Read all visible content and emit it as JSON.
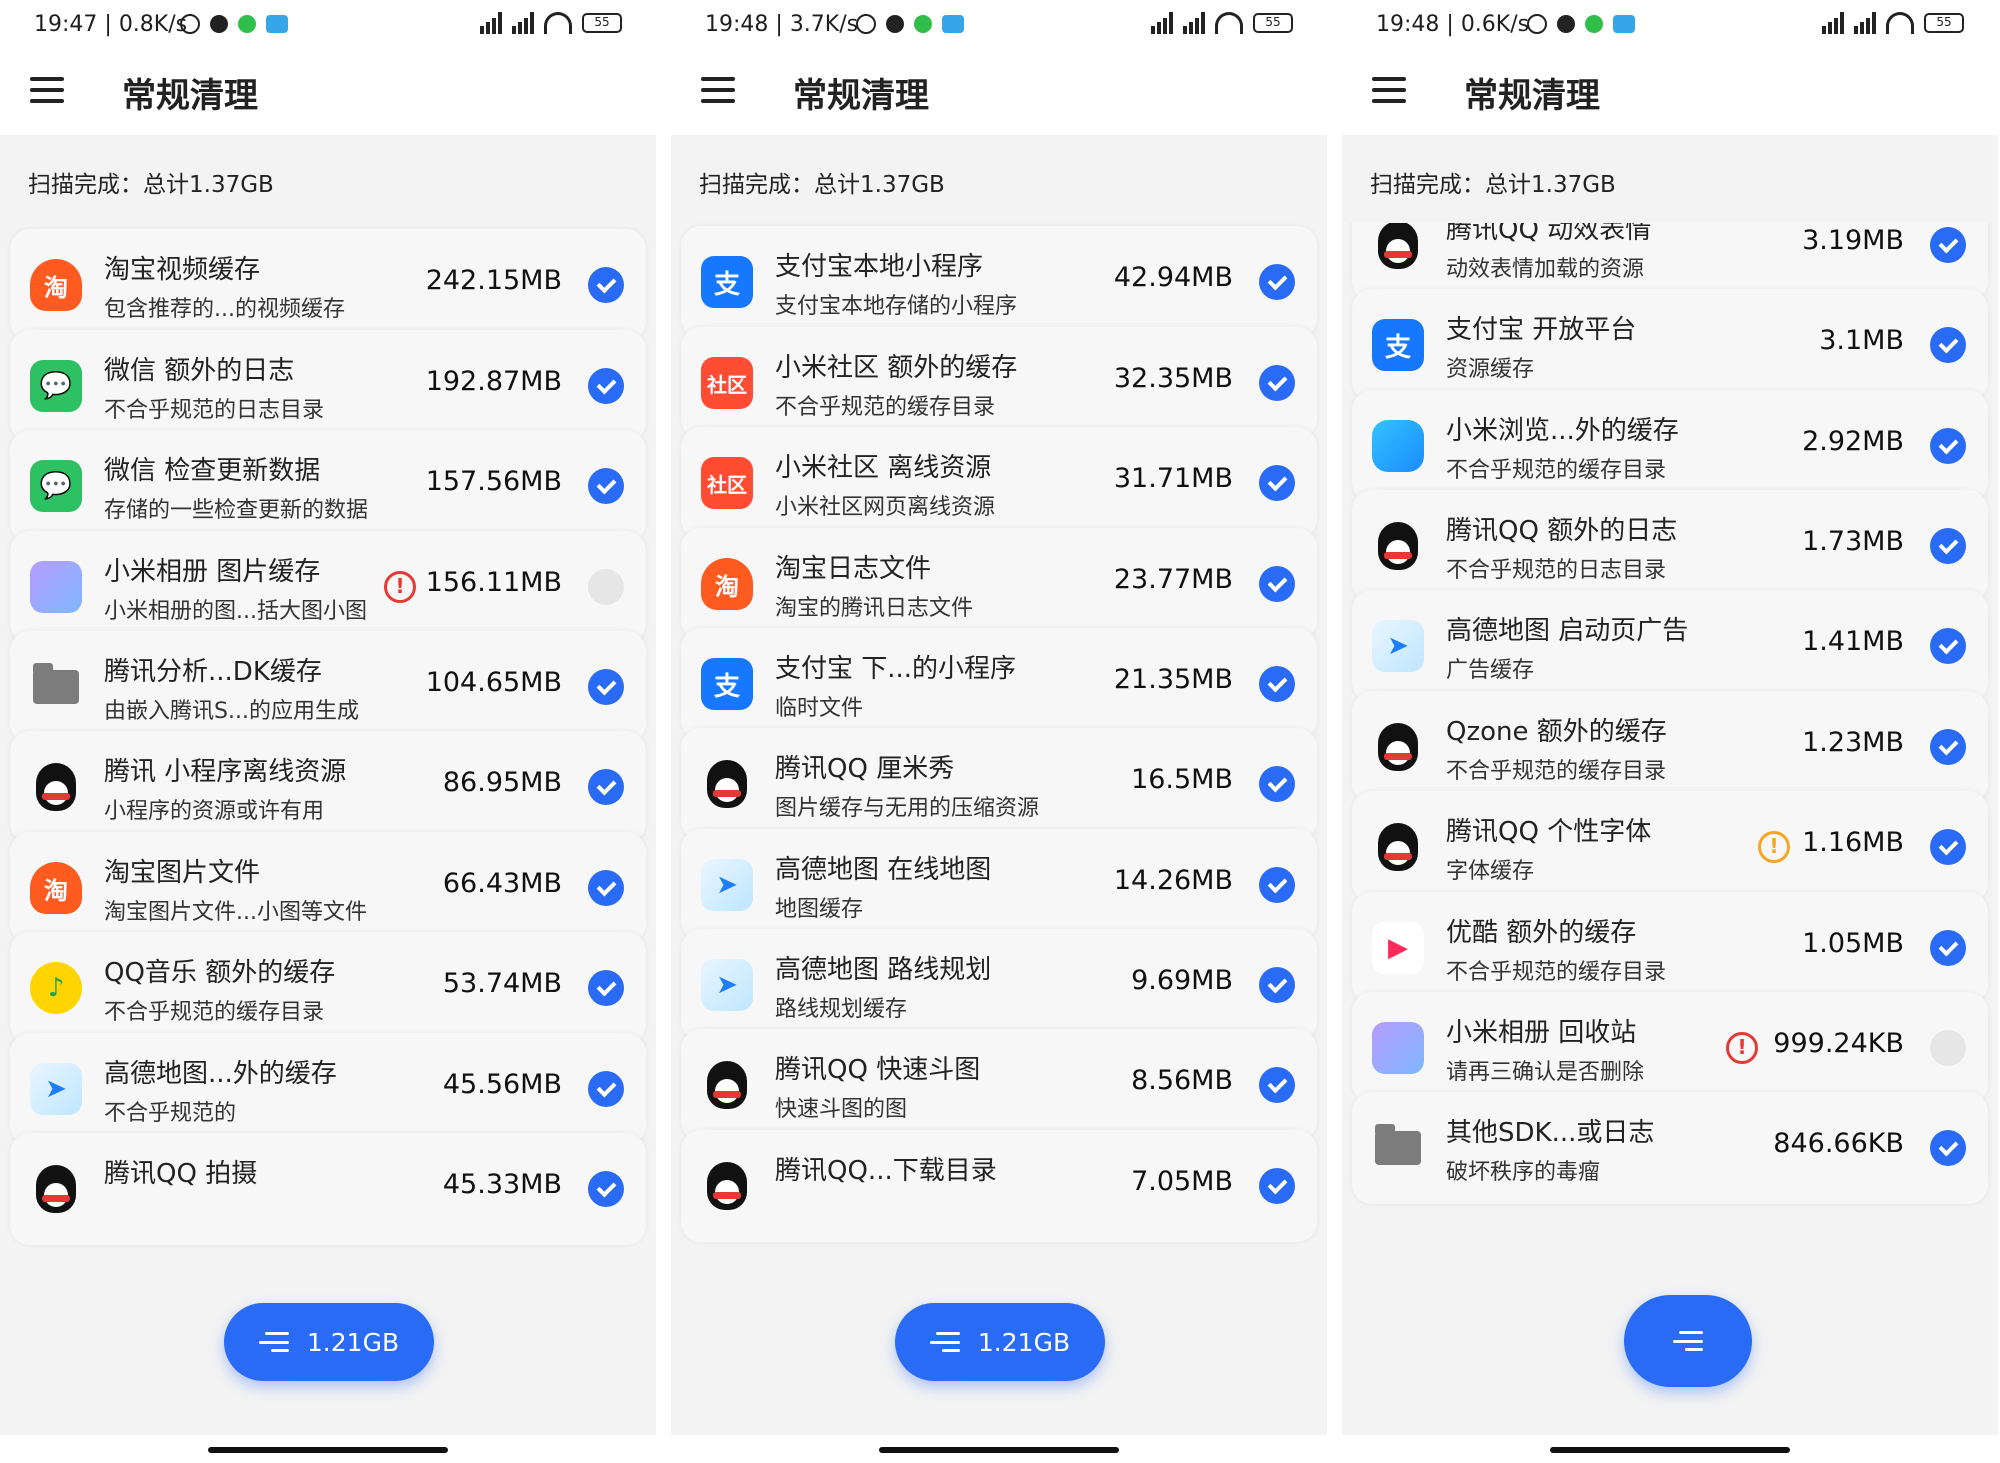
{
  "panels": [
    {
      "status": {
        "time": "19:47",
        "speed": "0.8K/s",
        "battery": "55"
      },
      "title": "常规清理",
      "scan_summary": "扫描完成：总计1.37GB",
      "fab_label": "1.21GB",
      "items": [
        {
          "icon": "taobao-icon",
          "title": "淘宝视频缓存",
          "subtitle": "包含推荐的...的视频缓存",
          "size": "242.15MB",
          "checked": true,
          "warn": ""
        },
        {
          "icon": "wechat-icon",
          "title": "微信 额外的日志",
          "subtitle": "不合乎规范的日志目录",
          "size": "192.87MB",
          "checked": true,
          "warn": ""
        },
        {
          "icon": "wechat-icon",
          "title": "微信 检查更新数据",
          "subtitle": "存储的一些检查更新的数据",
          "size": "157.56MB",
          "checked": true,
          "warn": ""
        },
        {
          "icon": "xiaomi-album-icon",
          "title": "小米相册 图片缓存",
          "subtitle": "小米相册的图...括大图小图",
          "size": "156.11MB",
          "checked": false,
          "warn": "red"
        },
        {
          "icon": "folder-icon",
          "title": "腾讯分析...DK缓存",
          "subtitle": "由嵌入腾讯S...的应用生成",
          "size": "104.65MB",
          "checked": true,
          "warn": ""
        },
        {
          "icon": "qq-icon",
          "title": "腾讯 小程序离线资源",
          "subtitle": "小程序的资源或许有用",
          "size": "86.95MB",
          "checked": true,
          "warn": ""
        },
        {
          "icon": "taobao-icon",
          "title": "淘宝图片文件",
          "subtitle": "淘宝图片文件...小图等文件",
          "size": "66.43MB",
          "checked": true,
          "warn": ""
        },
        {
          "icon": "qq-music-icon",
          "title": "QQ音乐 额外的缓存",
          "subtitle": "不合乎规范的缓存目录",
          "size": "53.74MB",
          "checked": true,
          "warn": ""
        },
        {
          "icon": "amap-icon",
          "title": "高德地图...外的缓存",
          "subtitle": "不合乎规范的",
          "size": "45.56MB",
          "checked": true,
          "warn": ""
        },
        {
          "icon": "qq-icon",
          "title": "腾讯QQ 拍摄",
          "subtitle": "",
          "size": "45.33MB",
          "checked": true,
          "warn": ""
        }
      ]
    },
    {
      "status": {
        "time": "19:48",
        "speed": "3.7K/s",
        "battery": "55"
      },
      "title": "常规清理",
      "scan_summary": "扫描完成：总计1.37GB",
      "fab_label": "1.21GB",
      "items": [
        {
          "icon": "alipay-icon",
          "title": "支付宝本地小程序",
          "subtitle": "支付宝本地存储的小程序",
          "size": "42.94MB",
          "checked": true,
          "warn": ""
        },
        {
          "icon": "xiaomi-community-icon",
          "title": "小米社区 额外的缓存",
          "subtitle": "不合乎规范的缓存目录",
          "size": "32.35MB",
          "checked": true,
          "warn": ""
        },
        {
          "icon": "xiaomi-community-icon",
          "title": "小米社区 离线资源",
          "subtitle": "小米社区网页离线资源",
          "size": "31.71MB",
          "checked": true,
          "warn": ""
        },
        {
          "icon": "taobao-icon",
          "title": "淘宝日志文件",
          "subtitle": "淘宝的腾讯日志文件",
          "size": "23.77MB",
          "checked": true,
          "warn": ""
        },
        {
          "icon": "alipay-icon",
          "title": "支付宝 下...的小程序",
          "subtitle": "临时文件",
          "size": "21.35MB",
          "checked": true,
          "warn": ""
        },
        {
          "icon": "qq-icon",
          "title": "腾讯QQ 厘米秀",
          "subtitle": "图片缓存与无用的压缩资源",
          "size": "16.5MB",
          "checked": true,
          "warn": ""
        },
        {
          "icon": "amap-icon",
          "title": "高德地图 在线地图",
          "subtitle": "地图缓存",
          "size": "14.26MB",
          "checked": true,
          "warn": ""
        },
        {
          "icon": "amap-icon",
          "title": "高德地图 路线规划",
          "subtitle": "路线规划缓存",
          "size": "9.69MB",
          "checked": true,
          "warn": ""
        },
        {
          "icon": "qq-icon",
          "title": "腾讯QQ 快速斗图",
          "subtitle": "快速斗图的图",
          "size": "8.56MB",
          "checked": true,
          "warn": ""
        },
        {
          "icon": "qq-icon",
          "title": "腾讯QQ...下载目录",
          "subtitle": "",
          "size": "7.05MB",
          "checked": true,
          "warn": ""
        }
      ]
    },
    {
      "status": {
        "time": "19:48",
        "speed": "0.6K/s",
        "battery": "55"
      },
      "title": "常规清理",
      "scan_summary": "扫描完成：总计1.37GB",
      "fab_label": "",
      "items": [
        {
          "icon": "qq-icon",
          "title": "腾讯QQ 动效表情",
          "subtitle": "动效表情加载的资源",
          "size": "3.19MB",
          "checked": true,
          "warn": ""
        },
        {
          "icon": "alipay-icon",
          "title": "支付宝 开放平台",
          "subtitle": "资源缓存",
          "size": "3.1MB",
          "checked": true,
          "warn": ""
        },
        {
          "icon": "xiaomi-browser-icon",
          "title": "小米浏览...外的缓存",
          "subtitle": "不合乎规范的缓存目录",
          "size": "2.92MB",
          "checked": true,
          "warn": ""
        },
        {
          "icon": "qq-icon",
          "title": "腾讯QQ 额外的日志",
          "subtitle": "不合乎规范的日志目录",
          "size": "1.73MB",
          "checked": true,
          "warn": ""
        },
        {
          "icon": "amap-icon",
          "title": "高德地图 启动页广告",
          "subtitle": "广告缓存",
          "size": "1.41MB",
          "checked": true,
          "warn": ""
        },
        {
          "icon": "qq-icon",
          "title": "Qzone 额外的缓存",
          "subtitle": "不合乎规范的缓存目录",
          "size": "1.23MB",
          "checked": true,
          "warn": ""
        },
        {
          "icon": "qq-icon",
          "title": "腾讯QQ 个性字体",
          "subtitle": "字体缓存",
          "size": "1.16MB",
          "checked": true,
          "warn": "orange"
        },
        {
          "icon": "youku-icon",
          "title": "优酷 额外的缓存",
          "subtitle": "不合乎规范的缓存目录",
          "size": "1.05MB",
          "checked": true,
          "warn": ""
        },
        {
          "icon": "xiaomi-album-icon",
          "title": "小米相册 回收站",
          "subtitle": "请再三确认是否删除",
          "size": "999.24KB",
          "checked": false,
          "warn": "red"
        },
        {
          "icon": "folder-icon",
          "title": "其他SDK...或日志",
          "subtitle": "破坏秩序的毒瘤",
          "size": "846.66KB",
          "checked": true,
          "warn": ""
        }
      ]
    }
  ],
  "icon_glyphs": {
    "taobao-icon": "淘",
    "wechat-icon": "💬",
    "alipay-icon": "支",
    "xiaomi-community-icon": "社区",
    "qq-music-icon": "♪",
    "amap-icon": "➤",
    "xiaomi-album-icon": "",
    "xiaomi-browser-icon": "",
    "youku-icon": "▶",
    "folder-icon": "",
    "qq-icon": ""
  },
  "colors": {
    "accent": "#2a6bf5",
    "warn_red": "#e53935",
    "warn_orange": "#f5a623",
    "card_bg": "#f7f7f7"
  }
}
